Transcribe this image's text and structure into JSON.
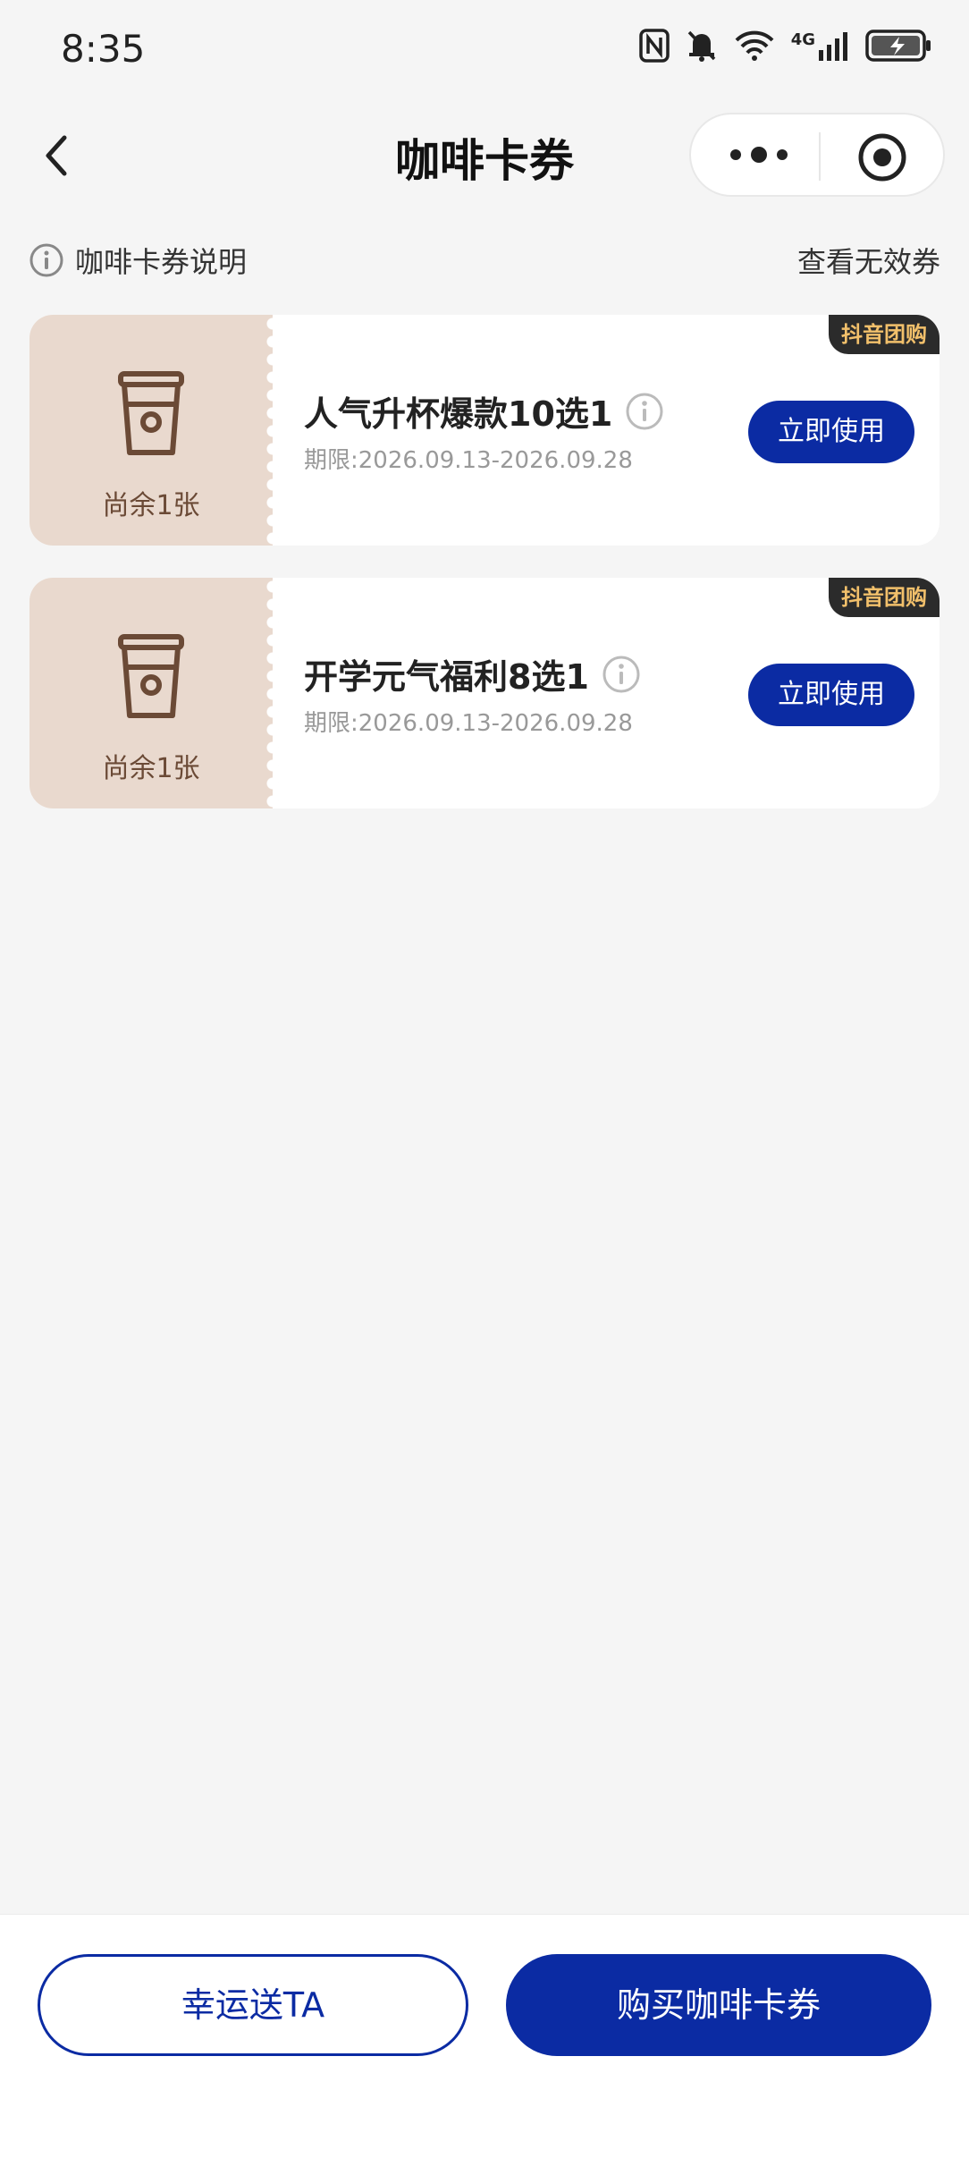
{
  "status_bar": {
    "time": "8:35",
    "network": "4G",
    "icons": [
      "nfc-icon",
      "bell-muted-icon",
      "wifi-icon",
      "signal-icon",
      "battery-charging-icon"
    ]
  },
  "nav": {
    "title": "咖啡卡券",
    "icons": [
      "back-chevron-icon",
      "more-dots-icon",
      "target-icon"
    ]
  },
  "info_row": {
    "left_label": "咖啡卡券说明",
    "right_label": "查看无效券"
  },
  "coupons": [
    {
      "remaining": "尚余1张",
      "tag": "抖音团购",
      "title": "人气升杯爆款10选1",
      "date": "期限:2026.09.13-2026.09.28",
      "button": "立即使用"
    },
    {
      "remaining": "尚余1张",
      "tag": "抖音团购",
      "title": "开学元气福利8选1",
      "date": "期限:2026.09.13-2026.09.28",
      "button": "立即使用"
    }
  ],
  "bottom": {
    "gift_label": "幸运送TA",
    "buy_label": "购买咖啡卡券"
  },
  "colors": {
    "primary": "#0b2ba3",
    "coupon_left_bg": "#e9d9ce",
    "coupon_brown": "#6b4a36",
    "tag_bg": "#2b2b2b",
    "tag_text": "#f2c06b",
    "page_bg": "#f5f5f5"
  }
}
